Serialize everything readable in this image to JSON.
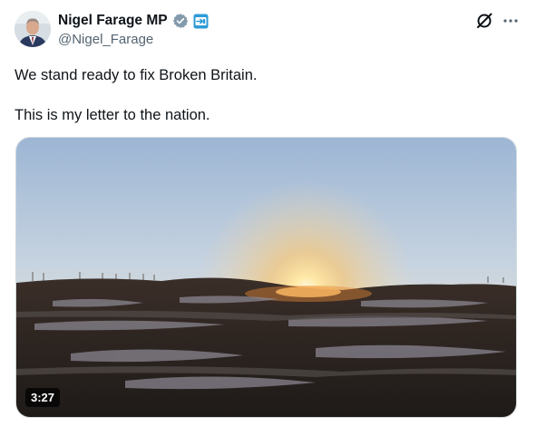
{
  "author": {
    "display_name": "Nigel Farage MP",
    "handle": "@Nigel_Farage",
    "verified_icon": "verified-badge-icon",
    "affiliation_icon": "affiliation-badge-icon"
  },
  "actions": {
    "grok_icon": "grok-icon",
    "more_icon": "more-options-icon"
  },
  "tweet": {
    "line1": "We stand ready to fix Broken Britain.",
    "line2": "This is my letter to the nation."
  },
  "media": {
    "type": "video",
    "duration": "3:27",
    "scene": "sunset-landscape"
  },
  "colors": {
    "text": "#0f1419",
    "secondary": "#536471",
    "verified": "#829aab",
    "border": "#cfd9de"
  }
}
